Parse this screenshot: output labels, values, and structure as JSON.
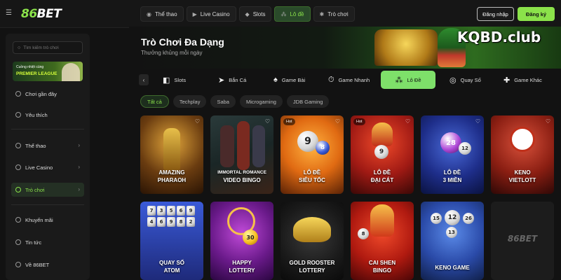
{
  "header": {
    "logo_prefix": "86",
    "logo_suffix": "BET",
    "nav": [
      {
        "label": "Thể thao",
        "icon": "sports-icon"
      },
      {
        "label": "Live Casino",
        "icon": "live-casino-icon"
      },
      {
        "label": "Slots",
        "icon": "slots-icon"
      },
      {
        "label": "Lô đề",
        "icon": "lottery-icon",
        "active": true
      },
      {
        "label": "Trò chơi",
        "icon": "games-icon"
      }
    ],
    "login_label": "Đăng nhập",
    "register_label": "Đăng ký"
  },
  "sidebar": {
    "search_placeholder": "Tìm kiếm trò chơi",
    "promo_line1": "Cuồng nhiệt cùng",
    "promo_line2": "PREMIER LEAGUE",
    "items": [
      {
        "label": "Chơi gần đây",
        "icon": "recent-icon"
      },
      {
        "label": "Yêu thích",
        "icon": "heart-icon"
      },
      {
        "label": "Thể thao",
        "icon": "sports-icon"
      },
      {
        "label": "Live Casino",
        "icon": "live-casino-icon"
      },
      {
        "label": "Trò chơi",
        "icon": "games-icon",
        "active": true
      },
      {
        "label": "Khuyến mãi",
        "icon": "promo-icon"
      },
      {
        "label": "Tin tức",
        "icon": "news-icon"
      },
      {
        "label": "Về 86BET",
        "icon": "info-icon"
      }
    ]
  },
  "banner": {
    "title": "Trò Chơi Đa Dạng",
    "subtitle": "Thưởng khủng mỗi ngày",
    "watermark": "KQBD.club"
  },
  "categories": [
    {
      "label": "Slots",
      "icon": "slots-icon"
    },
    {
      "label": "Bắn Cá",
      "icon": "fish-icon"
    },
    {
      "label": "Game Bài",
      "icon": "cards-icon"
    },
    {
      "label": "Game Nhanh",
      "icon": "fast-game-icon"
    },
    {
      "label": "Lô Đề",
      "icon": "lottery-icon",
      "active": true
    },
    {
      "label": "Quay Số",
      "icon": "wheel-icon"
    },
    {
      "label": "Game Khác",
      "icon": "other-games-icon"
    }
  ],
  "filters": [
    "Tất cả",
    "Techplay",
    "Saba",
    "Microgaming",
    "JDB Gaming"
  ],
  "games_row1": [
    {
      "line1": "AMAZING",
      "line2": "PHARAOH",
      "hot": ""
    },
    {
      "line1": "IMMORTAL ROMANCE",
      "line2": "VIDEO BINGO",
      "hot": ""
    },
    {
      "line1": "LÔ ĐỀ",
      "line2": "SIÊU TỐC",
      "hot": "Hot"
    },
    {
      "line1": "LÔ ĐỀ",
      "line2": "ĐẠI CÁT",
      "hot": "Hot"
    },
    {
      "line1": "LÔ ĐỀ",
      "line2": "3 MIỀN",
      "hot": ""
    },
    {
      "line1": "KENO",
      "line2": "VIETLOTT",
      "hot": ""
    }
  ],
  "games_row2": [
    {
      "line1": "QUAY SỐ",
      "line2": "ATOM"
    },
    {
      "line1": "HAPPY",
      "line2": "LOTTERY"
    },
    {
      "line1": "GOLD ROOSTER",
      "line2": "LOTTERY"
    },
    {
      "line1": "CAI SHEN",
      "line2": "BINGO"
    },
    {
      "line1": "KENO GAME",
      "line2": ""
    },
    {
      "line1": "",
      "line2": ""
    }
  ],
  "placeholder_logo": "86BET",
  "ball_numbers": {
    "c2a": "9",
    "c2b": "8",
    "c3": "9",
    "c4": "28",
    "c4b": "12",
    "r2c2": "30",
    "r2c4": "8",
    "r2c5a": "15",
    "r2c5b": "12",
    "r2c5c": "26",
    "r2c5d": "13"
  },
  "atom_numbers": [
    "7",
    "3",
    "5",
    "6",
    "9",
    "4",
    "6",
    "9",
    "8",
    "2"
  ],
  "colors": {
    "accent": "#8be24a",
    "background": "#121212",
    "sidebar": "#1a1a1a"
  }
}
